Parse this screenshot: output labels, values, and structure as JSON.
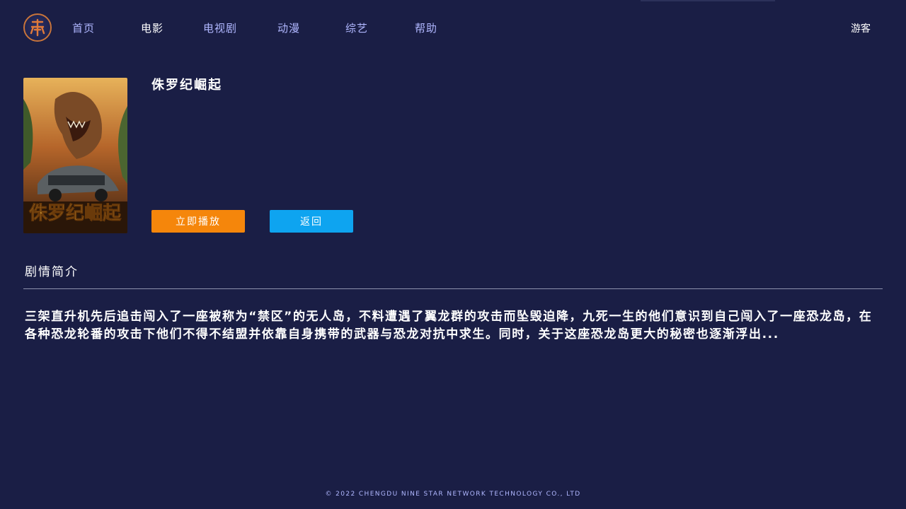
{
  "nav": {
    "items": [
      {
        "label": "首页",
        "active": false
      },
      {
        "label": "电影",
        "active": true
      },
      {
        "label": "电视剧",
        "active": false
      },
      {
        "label": "动漫",
        "active": false
      },
      {
        "label": "综艺",
        "active": false
      },
      {
        "label": "帮助",
        "active": false
      }
    ],
    "user_label": "游客"
  },
  "logo": {
    "icon": "star-seal-logo",
    "color": "#c8743a"
  },
  "movie": {
    "title": "侏罗纪崛起",
    "poster_text": "侏罗纪崛起",
    "play_label": "立即播放",
    "back_label": "返回"
  },
  "synopsis": {
    "heading": "剧情简介",
    "text": "三架直升机先后追击闯入了一座被称为“禁区”的无人岛，不料遭遇了翼龙群的攻击而坠毁迫降，九死一生的他们意识到自己闯入了一座恐龙岛，在各种恐龙轮番的攻击下他们不得不结盟并依靠自身携带的武器与恐龙对抗中求生。同时，关于这座恐龙岛更大的秘密也逐渐浮出..."
  },
  "footer": {
    "text": "© 2022 CHENGDU NINE STAR NETWORK TECHNOLOGY CO., LTD"
  },
  "colors": {
    "background": "#1a1e45",
    "nav_text": "#b0b7ff",
    "play_button": "#f5860b",
    "back_button": "#0ea4f0"
  }
}
